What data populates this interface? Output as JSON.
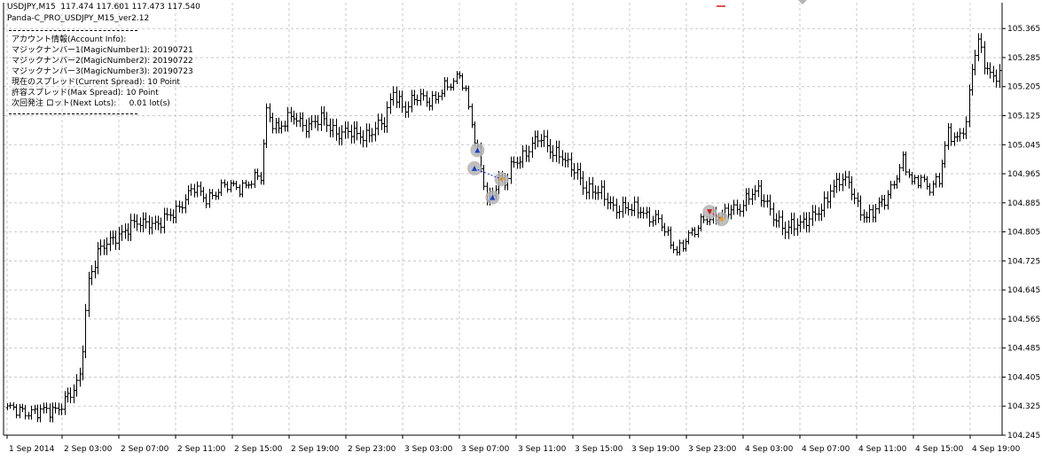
{
  "header": {
    "symbol_line": "USDJPY,M15  117.474 117.601 117.473 117.540",
    "ea_name": "Panda-C_PRO_USDJPY_M15_ver2.12"
  },
  "info_panel": {
    "lines": [
      "アカウント情報(Account Info):",
      "マジックナンバー1(MagicNumber1): 20190721",
      "マジックナンバー2(MagicNumber2): 20190722",
      "マジックナンバー3(MagicNumber3): 20190723",
      "現在のスプレッド(Current Spread): 10 Point",
      "許容スプレッド(Max Spread): 10 Point",
      "次回発注 ロット(Next Lots):     0.01 lot(s)"
    ]
  },
  "colors": {
    "background": "#ffffff",
    "grid": "#c8c8c8",
    "bars": "#000000",
    "buy_marker": "#1a3fd0",
    "sell_marker": "#d01a1a",
    "close_marker": "#e8a020",
    "marker_halo": "#b4b4b4"
  },
  "chart_data": {
    "type": "ohlc",
    "symbol": "USDJPY",
    "timeframe": "M15",
    "grid": true,
    "ylim": [
      104.245,
      105.385
    ],
    "y_ticks": [
      "105.365",
      "105.285",
      "105.205",
      "105.125",
      "105.045",
      "104.965",
      "104.885",
      "104.805",
      "104.725",
      "104.645",
      "104.565",
      "104.485",
      "104.405",
      "104.325",
      "104.245"
    ],
    "x_ticks": [
      "1 Sep 2014",
      "2 Sep 03:00",
      "2 Sep 07:00",
      "2 Sep 11:00",
      "2 Sep 15:00",
      "2 Sep 19:00",
      "2 Sep 23:00",
      "3 Sep 03:00",
      "3 Sep 07:00",
      "3 Sep 11:00",
      "3 Sep 15:00",
      "3 Sep 19:00",
      "3 Sep 23:00",
      "4 Sep 03:00",
      "4 Sep 07:00",
      "4 Sep 11:00",
      "4 Sep 15:00",
      "4 Sep 19:00"
    ],
    "close_anchors": [
      [
        0,
        104.31
      ],
      [
        5,
        104.32
      ],
      [
        10,
        104.3
      ],
      [
        15,
        104.32
      ],
      [
        18,
        104.33
      ],
      [
        22,
        104.36
      ],
      [
        24,
        104.41
      ],
      [
        27,
        104.68
      ],
      [
        30,
        104.74
      ],
      [
        33,
        104.77
      ],
      [
        36,
        104.8
      ],
      [
        40,
        104.81
      ],
      [
        44,
        104.83
      ],
      [
        47,
        104.84
      ],
      [
        50,
        104.82
      ],
      [
        53,
        104.84
      ],
      [
        56,
        104.87
      ],
      [
        59,
        104.9
      ],
      [
        62,
        104.92
      ],
      [
        65,
        104.9
      ],
      [
        70,
        104.92
      ],
      [
        75,
        104.93
      ],
      [
        80,
        104.94
      ],
      [
        84,
        104.95
      ],
      [
        86,
        105.14
      ],
      [
        90,
        105.09
      ],
      [
        95,
        105.12
      ],
      [
        100,
        105.1
      ],
      [
        105,
        105.11
      ],
      [
        110,
        105.08
      ],
      [
        115,
        105.07
      ],
      [
        120,
        105.08
      ],
      [
        125,
        105.1
      ],
      [
        128,
        105.2
      ],
      [
        132,
        105.14
      ],
      [
        137,
        105.18
      ],
      [
        142,
        105.17
      ],
      [
        147,
        105.21
      ],
      [
        150,
        105.25
      ],
      [
        152,
        105.19
      ],
      [
        155,
        105.05
      ],
      [
        157,
        104.98
      ],
      [
        159,
        104.9
      ],
      [
        161,
        104.92
      ],
      [
        163,
        104.95
      ],
      [
        165,
        104.93
      ],
      [
        168,
        105.0
      ],
      [
        171,
        105.02
      ],
      [
        174,
        105.04
      ],
      [
        177,
        105.06
      ],
      [
        180,
        105.04
      ],
      [
        183,
        105.02
      ],
      [
        186,
        104.98
      ],
      [
        189,
        104.97
      ],
      [
        192,
        104.93
      ],
      [
        195,
        104.91
      ],
      [
        198,
        104.9
      ],
      [
        201,
        104.88
      ],
      [
        204,
        104.87
      ],
      [
        207,
        104.86
      ],
      [
        210,
        104.87
      ],
      [
        213,
        104.85
      ],
      [
        216,
        104.83
      ],
      [
        219,
        104.79
      ],
      [
        222,
        104.76
      ],
      [
        225,
        104.78
      ],
      [
        228,
        104.8
      ],
      [
        231,
        104.85
      ],
      [
        234,
        104.85
      ],
      [
        237,
        104.84
      ],
      [
        240,
        104.87
      ],
      [
        243,
        104.88
      ],
      [
        246,
        104.9
      ],
      [
        249,
        104.91
      ],
      [
        252,
        104.89
      ],
      [
        255,
        104.84
      ],
      [
        258,
        104.8
      ],
      [
        261,
        104.83
      ],
      [
        264,
        104.84
      ],
      [
        267,
        104.84
      ],
      [
        270,
        104.86
      ],
      [
        273,
        104.93
      ],
      [
        276,
        104.95
      ],
      [
        279,
        104.93
      ],
      [
        282,
        104.88
      ],
      [
        285,
        104.85
      ],
      [
        288,
        104.86
      ],
      [
        291,
        104.89
      ],
      [
        294,
        104.95
      ],
      [
        297,
        105.0
      ],
      [
        300,
        104.93
      ],
      [
        303,
        104.96
      ],
      [
        306,
        104.93
      ],
      [
        309,
        104.94
      ],
      [
        312,
        105.08
      ],
      [
        315,
        105.07
      ],
      [
        318,
        105.1
      ],
      [
        320,
        105.25
      ],
      [
        322,
        105.33
      ],
      [
        324,
        105.28
      ],
      [
        327,
        105.23
      ],
      [
        330,
        105.24
      ]
    ],
    "trade_markers": [
      {
        "bar": 156,
        "price": 105.03,
        "kind": "buy"
      },
      {
        "bar": 155,
        "price": 104.98,
        "kind": "buy"
      },
      {
        "bar": 161,
        "price": 104.9,
        "kind": "buy"
      },
      {
        "bar": 164,
        "price": 104.95,
        "kind": "close"
      },
      {
        "bar": 233,
        "price": 104.86,
        "kind": "sell"
      },
      {
        "bar": 237,
        "price": 104.84,
        "kind": "close"
      }
    ]
  }
}
